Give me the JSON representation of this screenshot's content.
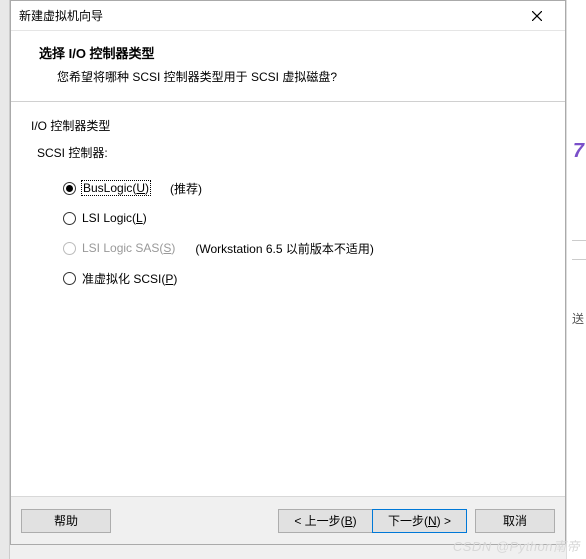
{
  "window": {
    "title": "新建虚拟机向导"
  },
  "header": {
    "title": "选择 I/O 控制器类型",
    "subtitle": "您希望将哪种 SCSI 控制器类型用于 SCSI 虚拟磁盘?"
  },
  "content": {
    "section_label": "I/O 控制器类型",
    "sub_label": "SCSI 控制器:",
    "options": [
      {
        "label_pre": "BusLogic(",
        "accel": "U",
        "label_post": ")",
        "note": "(推荐)",
        "selected": true,
        "disabled": false,
        "focused": true
      },
      {
        "label_pre": "LSI Logic(",
        "accel": "L",
        "label_post": ")",
        "note": "",
        "selected": false,
        "disabled": false,
        "focused": false
      },
      {
        "label_pre": "LSI Logic SAS(",
        "accel": "S",
        "label_post": ")",
        "note": "(Workstation 6.5 以前版本不适用)",
        "selected": false,
        "disabled": true,
        "focused": false
      },
      {
        "label_pre": "准虚拟化 SCSI(",
        "accel": "P",
        "label_post": ")",
        "note": "",
        "selected": false,
        "disabled": false,
        "focused": false
      }
    ]
  },
  "footer": {
    "help": "帮助",
    "back_pre": "< 上一步(",
    "back_accel": "B",
    "back_post": ")",
    "next_pre": "下一步(",
    "next_accel": "N",
    "next_post": ") >",
    "cancel": "取消"
  },
  "watermark": "CSDN @Python南帝",
  "strip": {
    "accent": "7",
    "text": "送"
  }
}
